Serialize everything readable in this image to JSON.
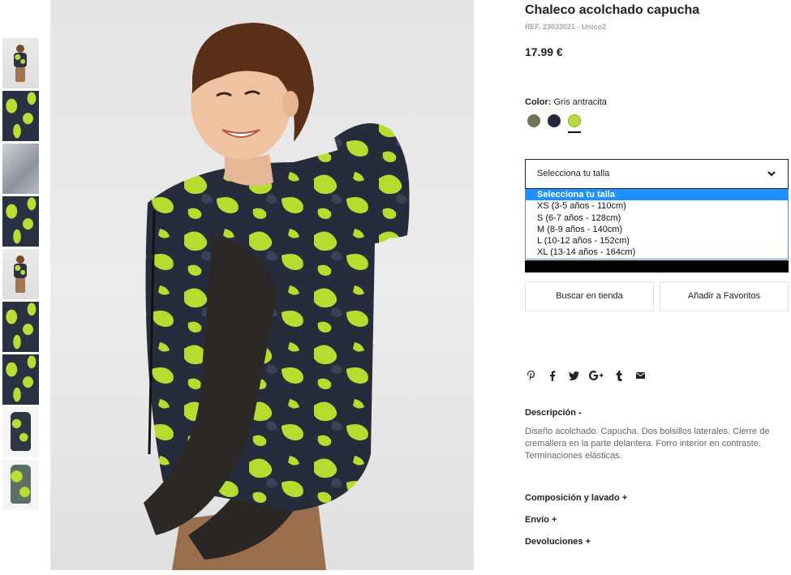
{
  "product": {
    "title": "Chaleco acolchado capucha",
    "ref": "REF. 23033021 - Unico2",
    "price": "17.99 €"
  },
  "color": {
    "label": "Color:",
    "value": "Gris antracita",
    "swatches": [
      {
        "name": "khaki",
        "hex": "#6e7558"
      },
      {
        "name": "navy",
        "hex": "#21263a"
      },
      {
        "name": "lime",
        "hex": "#b4dc3c",
        "selected": true
      }
    ]
  },
  "size": {
    "placeholder": "Selecciona tu talla",
    "options": [
      "Selecciona tu talla",
      "XS (3-5 años - 110cm)",
      "S (6-7 años - 128cm)",
      "M (8-9 años - 140cm)",
      "L (10-12 años - 152cm)",
      "XL (13-14 años - 164cm)"
    ]
  },
  "buttons": {
    "store": "Buscar en tienda",
    "favorites": "Añadir a Favoritos"
  },
  "social_icons": [
    "pinterest-icon",
    "facebook-icon",
    "twitter-icon",
    "google-plus-icon",
    "tumblr-icon",
    "email-icon"
  ],
  "description": {
    "heading": "Descripción  -",
    "text": "Diseño acolchado. Capucha. Dos bolsillos laterales. Cierre de cremallera en la parte delantera. Forro interior en contraste. Terminaciones elásticas."
  },
  "accordions": [
    "Composición y lavado  +",
    "Envío  +",
    "Devoluciones  +"
  ],
  "colors": {
    "accent": "#1e90ff",
    "text": "#222222"
  }
}
